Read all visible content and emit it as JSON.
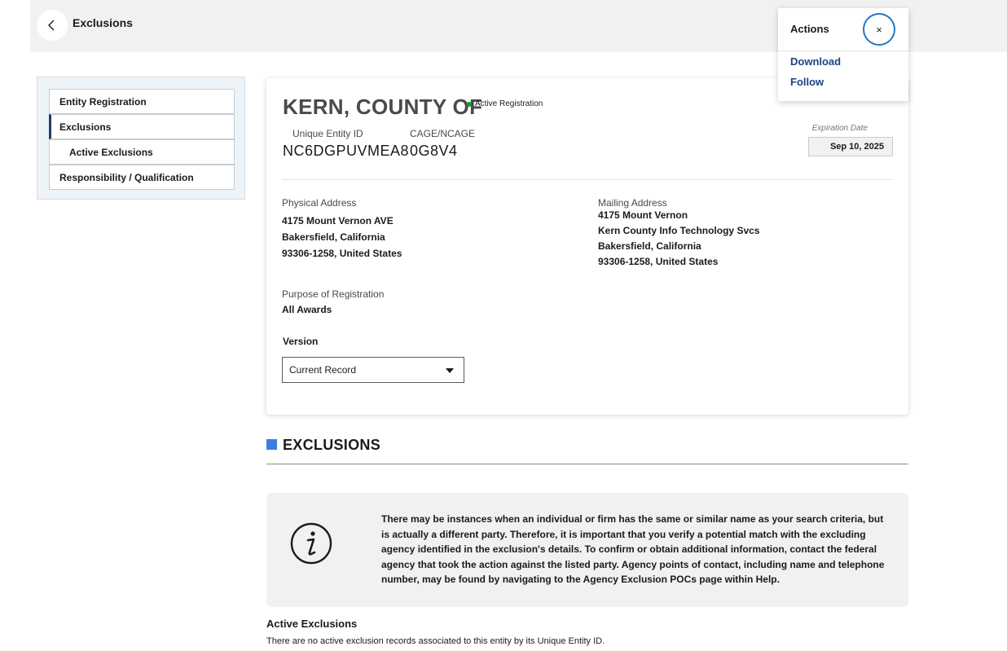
{
  "header": {
    "back_icon": "chevron-left-icon",
    "title": "Exclusions"
  },
  "sidebar": {
    "items": [
      {
        "label": "Entity Registration"
      },
      {
        "label": "Exclusions"
      },
      {
        "label": "Active Exclusions"
      },
      {
        "label": "Responsibility / Qualification"
      }
    ]
  },
  "entity": {
    "name": "KERN, COUNTY OF",
    "status": "Active Registration",
    "status_color": "#00a91c",
    "uei_label": "Unique Entity ID",
    "uei": "NC6DGPUVMEA8",
    "cage_label": "CAGE/NCAGE",
    "cage": "0G8V4",
    "expiration_label": "Expiration Date",
    "expiration": "Sep 10, 2025",
    "physical_label": "Physical Address",
    "physical": [
      "4175 Mount Vernon AVE",
      "Bakersfield, California",
      "93306-1258, United States"
    ],
    "mailing_label": "Mailing Address",
    "mailing": [
      "4175 Mount Vernon",
      "Kern County Info Technology Svcs",
      "Bakersfield, California",
      "93306-1258, United States"
    ],
    "purpose_label": "Purpose of Registration",
    "purpose": "All Awards",
    "version_label": "Version",
    "version_selected": "Current Record"
  },
  "exclusions": {
    "heading": "EXCLUSIONS",
    "accent_color": "#3d7ee0",
    "info_icon": "info-icon",
    "info_text": "There may be instances when an individual or firm has the same or similar name as your search criteria, but is actually a different party. Therefore, it is important that you verify a potential match with the excluding agency identified in the exclusion's details. To confirm or obtain additional information, contact the federal agency that took the action against the listed party. Agency points of contact, including name and telephone number, may be found by navigating to the Agency Exclusion POCs page within Help.",
    "active_title": "Active Exclusions",
    "active_note": "There are no active exclusion records associated to this entity by its Unique Entity ID."
  },
  "actions": {
    "title": "Actions",
    "close_icon": "close-icon",
    "close_glyph": "×",
    "links": [
      "Download",
      "Follow"
    ]
  }
}
